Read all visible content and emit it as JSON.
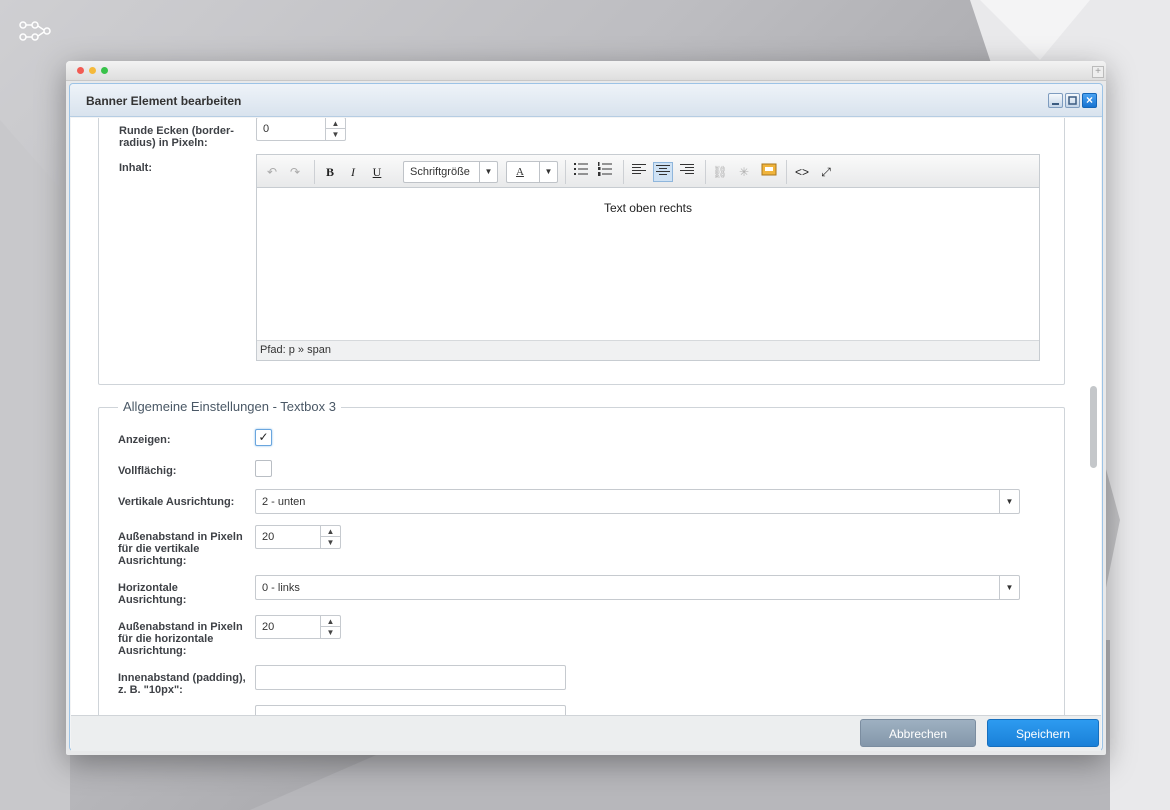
{
  "dialog": {
    "title": "Banner Element bearbeiten"
  },
  "section1": {
    "radius_label": "Runde Ecken (border-radius) in Pixeln:",
    "radius_value": "0",
    "content_label": "Inhalt:"
  },
  "editor": {
    "font_size_label": "Schriftgröße",
    "color_letter": "A",
    "content": "Text oben rechts",
    "path": "Pfad: p » span"
  },
  "section2": {
    "legend": "Allgemeine Einstellungen - Textbox 3",
    "show_label": "Anzeigen:",
    "show_checked": true,
    "full_label": "Vollflächig:",
    "full_checked": false,
    "valign_label": "Vertikale Ausrichtung:",
    "valign_value": "2 - unten",
    "vmargin_label": "Außenabstand in Pixeln für die vertikale Ausrichtung:",
    "vmargin_value": "20",
    "halign_label": "Horizontale Ausrichtung:",
    "halign_value": "0 - links",
    "hmargin_label": "Außenabstand in Pixeln für die horizontale Ausrichtung:",
    "hmargin_value": "20",
    "padding_label": "Innenabstand (padding), z. B. \"10px\":",
    "padding_value": ""
  },
  "footer": {
    "cancel_label": "Abbrechen",
    "save_label": "Speichern"
  },
  "colors": {
    "accent": "#1a88e0",
    "cancel": "#8fa1b2"
  }
}
